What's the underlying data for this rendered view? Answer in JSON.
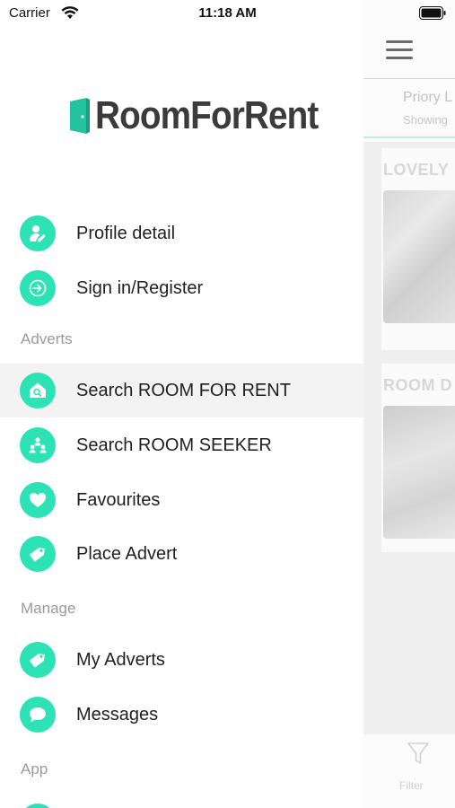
{
  "status_bar": {
    "carrier": "Carrier",
    "time": "11:18 AM"
  },
  "brand": {
    "name": "RoomForRent",
    "accent_color": "#2de3b6"
  },
  "drawer": {
    "items_top": [
      {
        "label": "Profile detail",
        "icon": "user-edit-icon"
      },
      {
        "label": "Sign in/Register",
        "icon": "sign-in-icon"
      }
    ],
    "sections": [
      {
        "title": "Adverts",
        "items": [
          {
            "label": "Search ROOM FOR RENT",
            "icon": "house-search-icon",
            "active": true
          },
          {
            "label": "Search ROOM SEEKER",
            "icon": "people-icon"
          },
          {
            "label": "Favourites",
            "icon": "heart-icon"
          },
          {
            "label": "Place Advert",
            "icon": "tag-icon"
          }
        ]
      },
      {
        "title": "Manage",
        "items": [
          {
            "label": "My Adverts",
            "icon": "tag-icon"
          },
          {
            "label": "Messages",
            "icon": "chat-bubble-icon"
          }
        ]
      },
      {
        "title": "App",
        "items": []
      }
    ]
  },
  "background_screen": {
    "location_title": "Priory L",
    "location_subtitle": "Showing",
    "listings": [
      {
        "title": "LOVELY"
      },
      {
        "title": "ROOM D"
      }
    ],
    "filter_label": "Filter"
  }
}
